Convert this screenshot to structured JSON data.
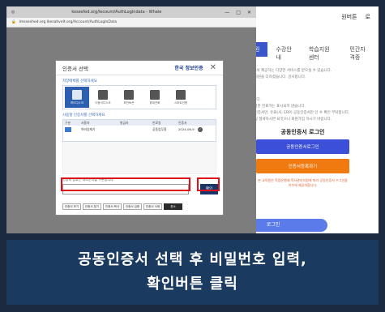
{
  "browser": {
    "tab_title": "kosesfed.org/lecount/AuthLogIndata - Whale",
    "address": "lmsseshed.org  lkesahvelt.org/Account/AuthLogInData",
    "controls": [
      "—",
      "□",
      "✕"
    ]
  },
  "site": {
    "top_links": [
      "원버튼",
      "로"
    ],
    "nav_tabs": [
      "원",
      "수강안내",
      "학습지원센터",
      "민간자격증"
    ],
    "paragraphs": [
      "회원께서 제공하는 다양한 서비스를 받으실 수 있습니다.",
      "교원 회원을 다하셨습니다. 감사합니다.",
      "하십니다.",
      "✓ 부정한 진료가는 표시되지 않습니다.",
      "원만 인증서만, 유료(사, ERP) 공동인증서만 인 수 확인 부탁합니다.",
      "로이 및 절세하시면 되것으니 회원가입 하시기 바랍니다."
    ],
    "login_title": "공동인증서 로그인",
    "cert_login_button": "공동인증서로그인",
    "cert_register_button": "인증서등록하기",
    "login_note": "본 교육원은 학점은행제 학사관리지침에 따라 공동인증서 수그인을 이수에 제공하합니다.",
    "login_button": "로그인"
  },
  "dialog": {
    "title": "인증서 선택",
    "brand": "한국 정보인증",
    "close": "✕",
    "media_label": "저장매체를 선택하세요",
    "media": [
      {
        "label": "하드디스크",
        "icon": "hard-disk-icon"
      },
      {
        "label": "이동식디스크",
        "icon": "usb-icon"
      },
      {
        "label": "보안토큰",
        "icon": "token-icon"
      },
      {
        "label": "휴대전화",
        "icon": "phone-icon"
      },
      {
        "label": "스마트인증",
        "icon": "smart-cert-icon"
      }
    ],
    "cert_label": "사용할 인증서를 선택하세요",
    "columns": [
      "구분",
      "사용자",
      "발급자",
      "만료일",
      "인증서"
    ],
    "certs": [
      {
        "type": "개인",
        "user": "여러승재기",
        "issuer": "",
        "expiry": "공동업무용",
        "date": "2024-06-9"
      }
    ],
    "password_label": "인증서 암호는 대소문자를 구분합니다.",
    "confirm": "확인",
    "buttons": [
      "인증서 보기",
      "인증서 찾기",
      "인증서 복사",
      "인증서 검증",
      "인증서 삭제",
      "취소"
    ]
  },
  "caption": {
    "line1": "공동인증서 선택 후 비밀번호 입력,",
    "line2": "확인버튼 클릭"
  }
}
